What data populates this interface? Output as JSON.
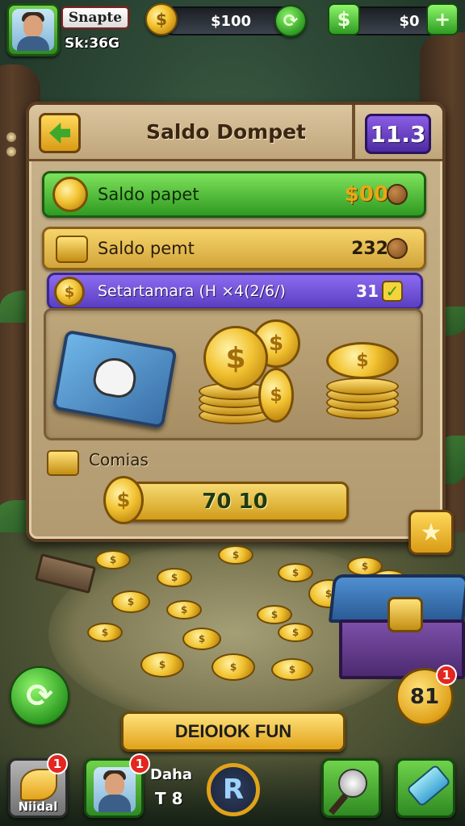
{
  "hud": {
    "player_name": "Snapte",
    "player_sub": "Sk:36G",
    "coins_value": "$100",
    "second_value": "$0",
    "coin_glyph": "$",
    "cash_glyph": "$",
    "add_glyph": "+",
    "refresh_glyph": "⟳"
  },
  "panel": {
    "title": "Saldo Dompet",
    "level": "11.3",
    "rows": [
      {
        "label": "Saldo papet",
        "value": "$00"
      },
      {
        "label": "Saldo pemt",
        "value": "232"
      },
      {
        "label": "Setartamara (H ×4(2/6/)",
        "value": "31",
        "check": "✓"
      }
    ],
    "comias_label": "Comias",
    "progress_value": "70 10",
    "star_glyph": "★"
  },
  "items": {
    "coin_glyph": "$"
  },
  "actions": {
    "refresh_glyph": "⟳",
    "cta_label": "DEIOIOK FUN",
    "badge_value": "81",
    "badge_notif": "1"
  },
  "bottom": {
    "slot1_caption": "Niidal",
    "slot1_notif": "1",
    "slot2_notif": "1",
    "slot_label": "Daha",
    "slot_value": "T 8",
    "r_glyph": "R"
  },
  "colors": {
    "accent_green": "#2f9a22",
    "accent_gold": "#e0a21a",
    "accent_purple": "#5a3fc1",
    "panel_bg": "#c9b48d"
  }
}
